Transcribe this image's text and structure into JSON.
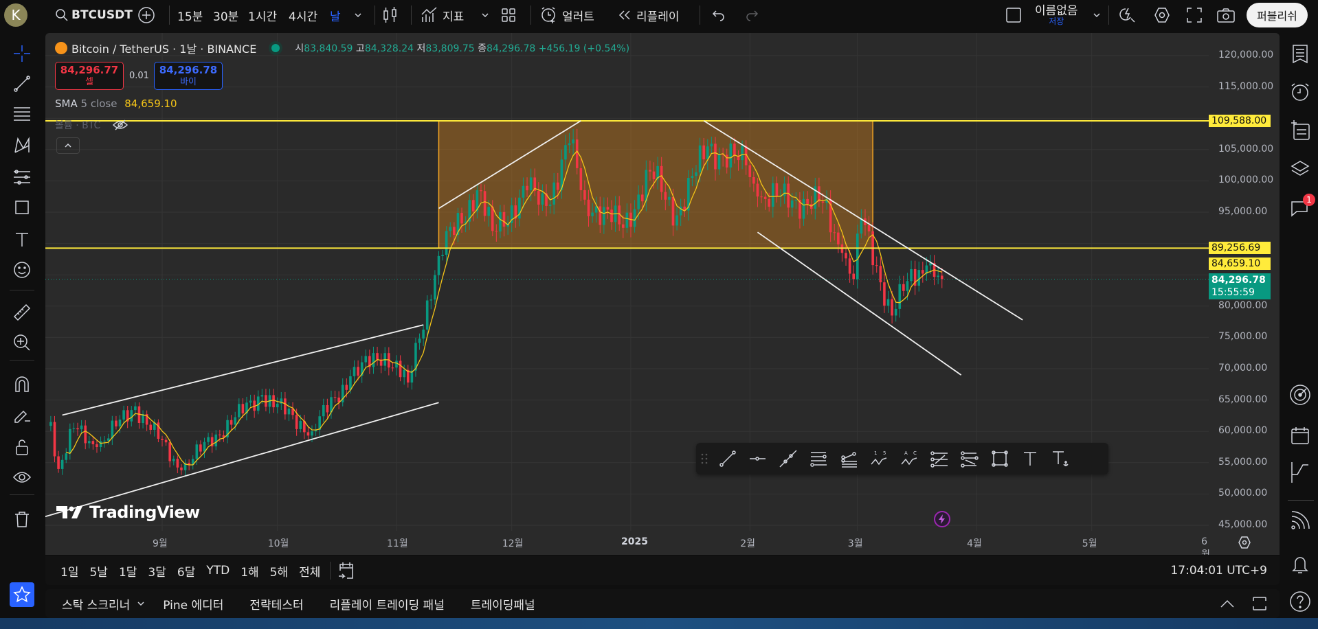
{
  "topbar": {
    "avatar_letter": "K",
    "symbol": "BTCUSDT",
    "intervals": [
      "15분",
      "30분",
      "1시간",
      "4시간",
      "날"
    ],
    "active_interval": "날",
    "indicators_label": "지표",
    "alert_label": "얼러트",
    "replay_label": "리플레이",
    "layout_name": "이름없음",
    "save_label": "저장",
    "publish_label": "퍼블리쉬"
  },
  "legend": {
    "title": "Bitcoin / TetherUS · 1날 · BINANCE",
    "open_label": "시",
    "open": "83,840.59",
    "high_label": "고",
    "high": "84,328.24",
    "low_label": "저",
    "low": "83,809.75",
    "close_label": "종",
    "close": "84,296.78",
    "change": "+456.19 (+0.54%)",
    "sell_price": "84,296.77",
    "sell_label": "셀",
    "spread": "0.01",
    "buy_price": "84,296.78",
    "buy_label": "바이",
    "sma_name": "SMA",
    "sma_params": "5 close",
    "sma_value": "84,659.10",
    "volume_label": "볼륨 · BTC"
  },
  "colors": {
    "up": "#089981",
    "down": "#f23645",
    "sma": "#f5c518",
    "hline": "#ffeb3b",
    "box_border": "#f5a623",
    "box_fill": "rgba(245,150,30,0.35)",
    "accent": "#2962ff"
  },
  "price_labels": {
    "hline_top": "109,588.00",
    "hline_bottom": "89,256.69",
    "sma": "84,659.10",
    "last": "84,296.78",
    "countdown": "15:55:59"
  },
  "chart_data": {
    "type": "candlestick",
    "symbol": "BTCUSDT",
    "interval": "1D",
    "y_ticks": [
      120000,
      115000,
      110000,
      105000,
      100000,
      95000,
      90000,
      85000,
      80000,
      75000,
      70000,
      65000,
      60000,
      55000,
      50000,
      45000
    ],
    "y_tick_labels": [
      "120,000.00",
      "115,000.00",
      "110,000.00",
      "105,000.00",
      "100,000.00",
      "95,000.00",
      "90,000.00",
      "85,000.00",
      "80,000.00",
      "75,000.00",
      "70,000.00",
      "65,000.00",
      "60,000.00",
      "55,000.00",
      "50,000.00",
      "45,000.00"
    ],
    "ylim": [
      45000,
      120000
    ],
    "x_ticks": [
      {
        "date": "2024-09-01",
        "label": "9월"
      },
      {
        "date": "2024-10-01",
        "label": "10월"
      },
      {
        "date": "2024-11-01",
        "label": "11월"
      },
      {
        "date": "2024-12-01",
        "label": "12월"
      },
      {
        "date": "2025-01-01",
        "label": "2025",
        "bold": true
      },
      {
        "date": "2025-02-01",
        "label": "2월"
      },
      {
        "date": "2025-03-01",
        "label": "3월"
      },
      {
        "date": "2025-04-01",
        "label": "4월"
      },
      {
        "date": "2025-05-01",
        "label": "5월"
      },
      {
        "date": "2025-06-01",
        "label": "6월"
      }
    ],
    "approx_closes": [
      [
        "2024-08-03",
        61500
      ],
      [
        "2024-08-05",
        54000
      ],
      [
        "2024-08-09",
        60500
      ],
      [
        "2024-08-15",
        57500
      ],
      [
        "2024-08-25",
        64000
      ],
      [
        "2024-09-06",
        53800
      ],
      [
        "2024-09-15",
        59500
      ],
      [
        "2024-09-27",
        65800
      ],
      [
        "2024-10-10",
        60000
      ],
      [
        "2024-10-20",
        68800
      ],
      [
        "2024-10-29",
        72500
      ],
      [
        "2024-11-04",
        67800
      ],
      [
        "2024-11-12",
        88000
      ],
      [
        "2024-11-22",
        98500
      ],
      [
        "2024-11-26",
        92000
      ],
      [
        "2024-12-05",
        98500
      ],
      [
        "2024-12-10",
        96000
      ],
      [
        "2024-12-16",
        106000
      ],
      [
        "2024-12-20",
        97000
      ],
      [
        "2024-12-30",
        92500
      ],
      [
        "2025-01-06",
        101500
      ],
      [
        "2025-01-13",
        94500
      ],
      [
        "2025-01-21",
        105500
      ],
      [
        "2025-01-31",
        102500
      ],
      [
        "2025-02-03",
        97500
      ],
      [
        "2025-02-20",
        96500
      ],
      [
        "2025-02-25",
        88500
      ],
      [
        "2025-02-28",
        84300
      ],
      [
        "2025-03-02",
        94000
      ],
      [
        "2025-03-10",
        78500
      ],
      [
        "2025-03-14",
        84000
      ],
      [
        "2025-03-19",
        86500
      ],
      [
        "2025-03-23",
        84296.78
      ]
    ],
    "sma_period": 5,
    "horizontal_lines": [
      109588,
      89256.69
    ],
    "rectangle": {
      "from": "2024-11-12",
      "to": "2025-03-05",
      "top": 109588,
      "bottom": 89256.69
    },
    "trend_lines": [
      {
        "from": [
          "2024-08-06",
          62600
        ],
        "to": [
          "2024-11-08",
          77000
        ]
      },
      {
        "from": [
          "2024-08-01",
          46300
        ],
        "to": [
          "2024-11-12",
          64600
        ]
      },
      {
        "from": [
          "2024-11-12",
          95600
        ],
        "to": [
          "2024-12-19",
          109600
        ]
      },
      {
        "from": [
          "2025-01-20",
          109600
        ],
        "to": [
          "2025-04-13",
          77800
        ]
      },
      {
        "from": [
          "2025-02-03",
          91800
        ],
        "to": [
          "2025-03-28",
          69000
        ]
      }
    ],
    "last_price": 84296.78
  },
  "drawing_toolbar": [
    "trend-line",
    "horizontal-ray",
    "extended-line",
    "parallel-channel",
    "pitchfork",
    "elliott-wave-15",
    "abcd-pattern",
    "fib-retracement",
    "fib-extension",
    "rectangle",
    "text",
    "anchored-text"
  ],
  "watermark": "TradingView",
  "range_bar": {
    "ranges": [
      "1일",
      "5날",
      "1달",
      "3달",
      "6달",
      "YTD",
      "1해",
      "5해",
      "전체"
    ],
    "clock": "17:04:01 UTC+9"
  },
  "bottom_panel": {
    "tabs": [
      "스탁 스크리너",
      "Pine 에디터",
      "전략테스터",
      "리플레이 트레이딩 패널",
      "트레이딩패널"
    ]
  },
  "right_toolbar": {
    "notification_badge": "1"
  }
}
